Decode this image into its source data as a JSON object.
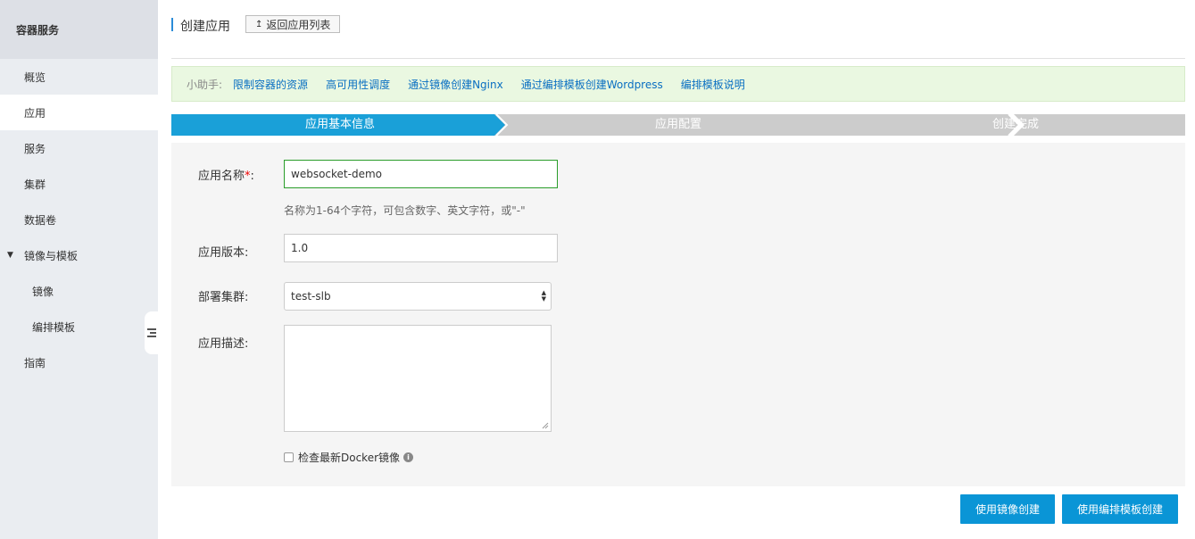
{
  "sidebar": {
    "header": "容器服务",
    "items": [
      {
        "label": "概览"
      },
      {
        "label": "应用"
      },
      {
        "label": "服务"
      },
      {
        "label": "集群"
      },
      {
        "label": "数据卷"
      },
      {
        "label": "镜像与模板"
      },
      {
        "label": "镜像"
      },
      {
        "label": "编排模板"
      },
      {
        "label": "指南"
      }
    ],
    "active_item": "应用"
  },
  "header": {
    "title": "创建应用",
    "back_label": "返回应用列表"
  },
  "helper": {
    "label": "小助手:",
    "links": [
      {
        "label": "限制容器的资源"
      },
      {
        "label": "高可用性调度"
      },
      {
        "label": "通过镜像创建Nginx"
      },
      {
        "label": "通过编排模板创建Wordpress"
      },
      {
        "label": "编排模板说明"
      }
    ]
  },
  "steps": [
    {
      "label": "应用基本信息",
      "state": "active"
    },
    {
      "label": "应用配置",
      "state": "inactive"
    },
    {
      "label": "创建完成",
      "state": "inactive"
    }
  ],
  "form": {
    "name_label": "应用名称",
    "name_required_mark": "*",
    "name_colon": ":",
    "name_value": "websocket-demo",
    "name_hint": "名称为1-64个字符，可包含数字、英文字符，或\"-\"",
    "version_label": "应用版本:",
    "version_value": "1.0",
    "cluster_label": "部署集群:",
    "cluster_value": "test-slb",
    "description_label": "应用描述:",
    "description_value": "",
    "check_docker_label": "检查最新Docker镜像",
    "check_docker_checked": false
  },
  "actions": {
    "create_from_image": "使用镜像创建",
    "create_from_template": "使用编排模板创建"
  },
  "colors": {
    "accent": "#0a95d6",
    "step_active": "#1aa0d8",
    "step_inactive": "#cccccc",
    "link": "#0a6fc2",
    "helper_bg": "#eaf8e1"
  }
}
